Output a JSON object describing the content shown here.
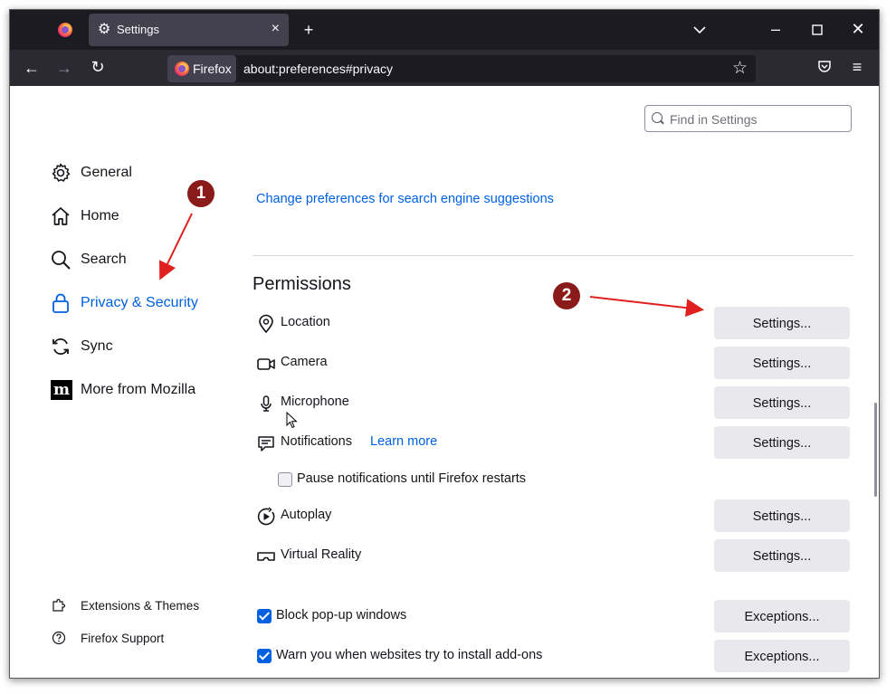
{
  "browser": {
    "tab_title": "Settings",
    "identity_label": "Firefox",
    "url": "about:preferences#privacy"
  },
  "search": {
    "placeholder": "Find in Settings"
  },
  "sidebar": {
    "items": [
      {
        "label": "General",
        "icon": "gear-icon"
      },
      {
        "label": "Home",
        "icon": "home-icon"
      },
      {
        "label": "Search",
        "icon": "search-icon"
      },
      {
        "label": "Privacy & Security",
        "icon": "lock-icon",
        "selected": true
      },
      {
        "label": "Sync",
        "icon": "sync-icon"
      },
      {
        "label": "More from Mozilla",
        "icon": "mozilla-icon"
      }
    ],
    "footer": [
      {
        "label": "Extensions & Themes",
        "icon": "puzzle-icon"
      },
      {
        "label": "Firefox Support",
        "icon": "help-icon"
      }
    ]
  },
  "main": {
    "search_suggestions_link": "Change preferences for search engine suggestions",
    "permissions_heading": "Permissions",
    "permissions": [
      {
        "label": "Location",
        "icon": "location-pin-icon",
        "button": "Settings..."
      },
      {
        "label": "Camera",
        "icon": "camera-icon",
        "button": "Settings..."
      },
      {
        "label": "Microphone",
        "icon": "microphone-icon",
        "button": "Settings..."
      },
      {
        "label": "Notifications",
        "icon": "notification-icon",
        "link": "Learn more",
        "button": "Settings..."
      },
      {
        "label": "Autoplay",
        "icon": "autoplay-icon",
        "button": "Settings..."
      },
      {
        "label": "Virtual Reality",
        "icon": "vr-headset-icon",
        "button": "Settings..."
      }
    ],
    "pause_notifications": {
      "label": "Pause notifications until Firefox restarts",
      "checked": false
    },
    "block_popups": {
      "label": "Block pop-up windows",
      "checked": true,
      "button": "Exceptions..."
    },
    "warn_addons": {
      "label": "Warn you when websites try to install add-ons",
      "checked": true,
      "button": "Exceptions..."
    }
  },
  "annotations": {
    "callout_1": "1",
    "callout_2": "2",
    "color": "#8b1a1a",
    "arrow_color": "#e0201e"
  },
  "colors": {
    "accent": "#0061e0",
    "tabbar": "#1c1b22",
    "navbar": "#2b2a33"
  }
}
